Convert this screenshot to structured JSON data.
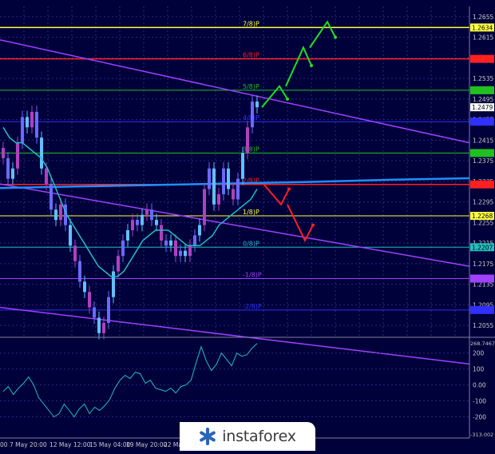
{
  "watermark": {
    "brand": "instaforex",
    "icon": "instaforex-logo-icon"
  },
  "colors": {
    "background": "#00003a",
    "grid": "#2a2a7a",
    "axis_text": "#c8c8c8",
    "candle": "#6a6aff",
    "candle_mid": "#b040c0",
    "candle_light": "#60c0ff",
    "sma": "#20c0c0",
    "trend": "#a040ff",
    "ma_blue": "#1e90ff",
    "murray_red": "#ff2020",
    "murray_yellow": "#ffff40",
    "murray_green": "#20c020",
    "murray_blue": "#3030ff",
    "murray_purple": "#a040ff",
    "murray_teal": "#20c0c0",
    "arrow_up": "#20e020",
    "arrow_down": "#ff2020",
    "cci": "#20c0c0"
  },
  "chart_data": {
    "type": "line",
    "instrument_panel": {
      "y_ticks": [
        "1.2655",
        "1.2615",
        "1.2575",
        "1.2535",
        "1.2495",
        "1.2455",
        "1.2415",
        "1.2375",
        "1.2335",
        "1.2295",
        "1.2255",
        "1.2215",
        "1.2175",
        "1.2135",
        "1.2095",
        "1.2055"
      ],
      "x_labels": [
        "00",
        "7 May 20:00",
        "12 May 12:00",
        "15 May 04:00",
        "19 May 20:00",
        "22 Ma"
      ],
      "price_badges": [
        {
          "value": "1.2634",
          "color": "#ffff40",
          "text_color": "#000000"
        },
        {
          "value": "1.2479",
          "color": "#ffffff",
          "text_color": "#000000"
        },
        {
          "value": "1.2268",
          "color": "#ffff40",
          "text_color": "#000000"
        },
        {
          "value": "1.2207",
          "color": "#20c0c0",
          "text_color": "#000000"
        }
      ],
      "murray_levels": [
        {
          "label": "7/8)P",
          "price": 1.2634,
          "color": "#ffff40"
        },
        {
          "label": "6/8)P",
          "price": 1.2573,
          "color": "#ff2020"
        },
        {
          "label": "5/8)P",
          "price": 1.2512,
          "color": "#20c020"
        },
        {
          "label": "4/8)P",
          "price": 1.2451,
          "color": "#3030ff"
        },
        {
          "label": "3/8)P",
          "price": 1.239,
          "color": "#20c020"
        },
        {
          "label": "2/8)P",
          "price": 1.2329,
          "color": "#ff2020"
        },
        {
          "label": "1/8)P",
          "price": 1.2268,
          "color": "#ffff40"
        },
        {
          "label": "0/8)P",
          "price": 1.2207,
          "color": "#20c0c0"
        },
        {
          "label": "-1/8)P",
          "price": 1.2146,
          "color": "#a040ff"
        },
        {
          "label": "-2/8)P",
          "price": 1.2085,
          "color": "#3030ff"
        }
      ],
      "close": [
        1.238,
        1.234,
        1.236,
        1.241,
        1.246,
        1.244,
        1.247,
        1.242,
        1.236,
        1.233,
        1.228,
        1.226,
        1.229,
        1.225,
        1.221,
        1.218,
        1.214,
        1.212,
        1.209,
        1.207,
        1.204,
        1.206,
        1.211,
        1.216,
        1.219,
        1.222,
        1.224,
        1.226,
        1.225,
        1.227,
        1.228,
        1.226,
        1.225,
        1.222,
        1.221,
        1.222,
        1.219,
        1.22,
        1.219,
        1.221,
        1.223,
        1.225,
        1.232,
        1.236,
        1.229,
        1.231,
        1.236,
        1.232,
        1.23,
        1.234,
        1.239,
        1.244,
        1.249,
        1.2479
      ],
      "sma": [
        1.244,
        1.242,
        1.241,
        1.241,
        1.24,
        1.239,
        1.238,
        1.236,
        1.233,
        1.23,
        1.227,
        1.225,
        1.223,
        1.221,
        1.219,
        1.217,
        1.216,
        1.215,
        1.215,
        1.216,
        1.218,
        1.22,
        1.222,
        1.223,
        1.224,
        1.224,
        1.224,
        1.223,
        1.222,
        1.221,
        1.221,
        1.221,
        1.222,
        1.223,
        1.225,
        1.226,
        1.227,
        1.228,
        1.229,
        1.23,
        1.232
      ],
      "ma_long": [
        1.2322,
        1.2325,
        1.2328,
        1.2331,
        1.2334,
        1.2338,
        1.2341
      ],
      "trend_lines": [
        {
          "points": [
            [
              0,
              1.261
            ],
            [
              -1,
              1.241
            ]
          ]
        },
        {
          "points": [
            [
              0,
              1.233
            ],
            [
              -1,
              1.217
            ]
          ]
        },
        {
          "points": [
            [
              0,
              1.209
            ],
            [
              -1,
              1.198
            ]
          ]
        }
      ],
      "forecast_up": [
        [
          1.2479,
          1.252,
          1.2495
        ],
        [
          1.252,
          1.2595,
          1.256
        ],
        [
          1.2595,
          1.2645,
          1.2615
        ]
      ],
      "forecast_down": [
        [
          1.233,
          1.229,
          1.232
        ],
        [
          1.229,
          1.222,
          1.225
        ]
      ]
    },
    "indicator_panel": {
      "name": "CCI",
      "y_ticks": [
        "200",
        "100",
        "0.00",
        "-100",
        "-200"
      ],
      "top_label": "268.7467",
      "bottom_label": "-313.002",
      "values": [
        -40,
        -10,
        -60,
        -20,
        10,
        50,
        0,
        -80,
        -120,
        -160,
        -200,
        -180,
        -120,
        -160,
        -200,
        -150,
        -120,
        -180,
        -140,
        -160,
        -130,
        -90,
        -20,
        30,
        60,
        40,
        80,
        70,
        10,
        30,
        -20,
        -30,
        -40,
        -20,
        -50,
        -10,
        0,
        30,
        140,
        240,
        150,
        90,
        130,
        200,
        160,
        120,
        200,
        180,
        190,
        230,
        260
      ]
    }
  }
}
